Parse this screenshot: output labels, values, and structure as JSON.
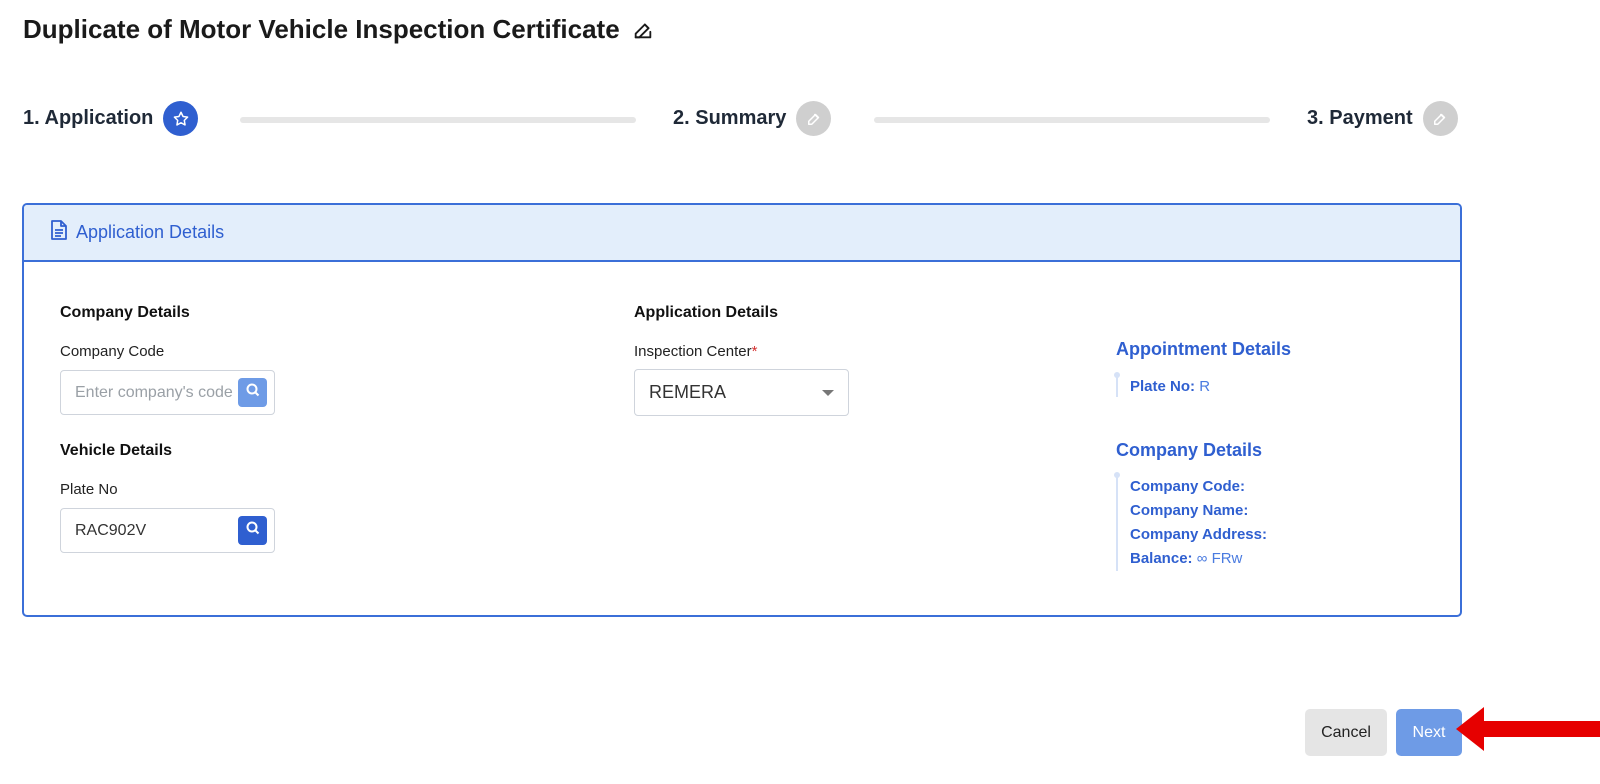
{
  "page": {
    "title": "Duplicate of Motor Vehicle Inspection Certificate",
    "title_icon": "edit-icon"
  },
  "stepper": {
    "steps": [
      {
        "label": "1. Application",
        "icon": "star-icon",
        "state": "active"
      },
      {
        "label": "2. Summary",
        "icon": "edit-icon",
        "state": "inactive"
      },
      {
        "label": "3. Payment",
        "icon": "edit-icon",
        "state": "inactive"
      }
    ]
  },
  "card": {
    "header_label": "Application Details",
    "header_icon": "document-icon"
  },
  "company_details": {
    "section_title": "Company Details",
    "code_label": "Company Code",
    "code_placeholder": "Enter company's code",
    "code_value": ""
  },
  "vehicle_details": {
    "section_title": "Vehicle Details",
    "plate_label": "Plate No",
    "plate_value": "RAC902V"
  },
  "application_details": {
    "section_title": "Application Details",
    "center_label": "Inspection Center",
    "center_required_mark": "*",
    "center_value": "REMERA"
  },
  "appointment_summary": {
    "title": "Appointment Details",
    "plate_label": "Plate No:",
    "plate_value": "R"
  },
  "company_summary": {
    "title": "Company Details",
    "code_label": "Company Code:",
    "name_label": "Company Name:",
    "address_label": "Company Address:",
    "balance_label": "Balance:",
    "balance_value": "∞ FRw"
  },
  "actions": {
    "cancel_label": "Cancel",
    "next_label": "Next"
  },
  "colors": {
    "primary": "#2f5fd0",
    "primary_light": "#6e9be6",
    "header_bg": "#e3eefb",
    "inactive_badge": "#cfcfcf",
    "annotation_arrow": "#e60000"
  }
}
